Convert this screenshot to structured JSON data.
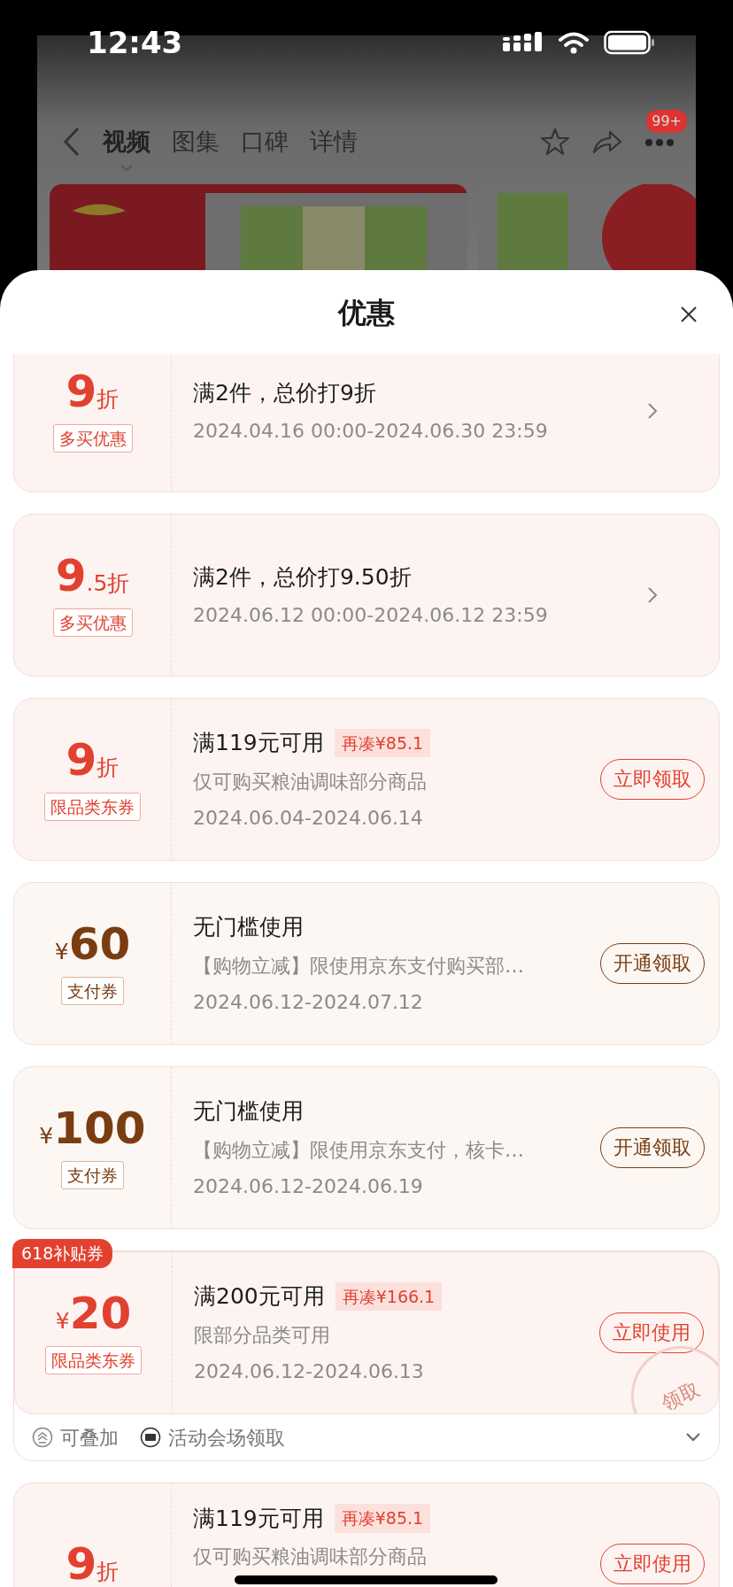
{
  "status_bar": {
    "time": "12:43"
  },
  "nav": {
    "tabs": [
      {
        "label": "视频",
        "selected": true
      },
      {
        "label": "图集",
        "selected": false
      },
      {
        "label": "口碑",
        "selected": false
      },
      {
        "label": "详情",
        "selected": false
      }
    ],
    "badge": "99+"
  },
  "sheet": {
    "title": "优惠",
    "coupons": [
      {
        "kind": "store",
        "number": "9",
        "suffix": "折",
        "tag": "多买优惠",
        "title": "满2件，总价打9折",
        "dates": "2024.04.16 00:00-2024.06.30 23:59",
        "action": {
          "kind": "chevron"
        }
      },
      {
        "kind": "store",
        "number": "9",
        "suffix": ".5折",
        "tag": "多买优惠",
        "title": "满2件，总价打9.50折",
        "dates": "2024.06.12 00:00-2024.06.12 23:59",
        "action": {
          "kind": "chevron"
        }
      },
      {
        "kind": "store",
        "number": "9",
        "suffix": "折",
        "tag": "限品类东券",
        "title": "满119元可用",
        "gap": "再凑¥85.1",
        "desc": "仅可购买粮油调味部分商品",
        "dates": "2024.06.04-2024.06.14",
        "action": {
          "kind": "button",
          "label": "立即领取"
        }
      },
      {
        "kind": "payment",
        "prefix": "¥",
        "number": "60",
        "tag": "支付券",
        "title": "无门槛使用",
        "desc": "【购物立减】限使用京东支付购买部…",
        "dates": "2024.06.12-2024.07.12",
        "action": {
          "kind": "button",
          "label": "开通领取"
        }
      },
      {
        "kind": "payment",
        "prefix": "¥",
        "number": "100",
        "tag": "支付券",
        "title": "无门槛使用",
        "desc": "【购物立减】限使用京东支付，核卡…",
        "dates": "2024.06.12-2024.06.19",
        "action": {
          "kind": "button",
          "label": "开通领取"
        }
      },
      {
        "kind": "store",
        "ribbon": "618补贴券",
        "prefix": "¥",
        "number": "20",
        "tag": "限品类东券",
        "title": "满200元可用",
        "gap": "再凑¥166.1",
        "desc": "限部分品类可用",
        "dates": "2024.06.12-2024.06.13",
        "action": {
          "kind": "button",
          "label": "立即使用"
        },
        "stamp": "领取",
        "footer": {
          "expanded": false,
          "items": [
            {
              "label": "可叠加"
            },
            {
              "label": "活动会场领取"
            }
          ]
        }
      },
      {
        "kind": "store",
        "number": "9",
        "suffix": "折",
        "title": "满119元可用",
        "gap": "再凑¥85.1",
        "desc": "仅可购买粮油调味部分商品",
        "action": {
          "kind": "button",
          "label": "立即使用"
        }
      }
    ]
  }
}
